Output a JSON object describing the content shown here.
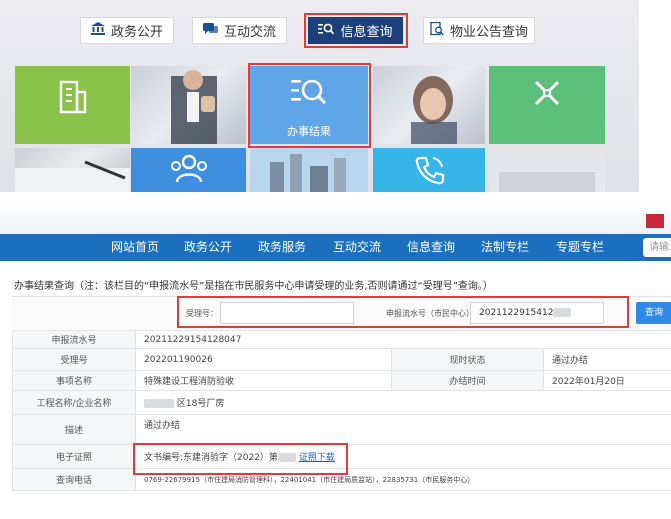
{
  "portal": {
    "tabs": [
      {
        "label": "政务公开",
        "icon": "bank-icon"
      },
      {
        "label": "互动交流",
        "icon": "chat-icon"
      },
      {
        "label": "信息查询",
        "icon": "search-list-icon",
        "active": true
      },
      {
        "label": "物业公告查询",
        "icon": "document-search-icon"
      }
    ],
    "highlight_tile_label": "办事结果"
  },
  "nav": {
    "items": [
      "网站首页",
      "政务公开",
      "政务服务",
      "互动交流",
      "信息查询",
      "法制专栏",
      "专题专栏"
    ],
    "search_placeholder": "请输入"
  },
  "notice": "办事结果查询（注：该栏目的“申报流水号”是指在市民服务中心申请受理的业务,否则请通过“受理号”查询。）",
  "search": {
    "accept_label": "受理号：",
    "accept_value": "",
    "serial_label": "申报流水号（市民中心）：",
    "serial_value": "2021122915412",
    "button": "查询"
  },
  "result": {
    "serial_key": "申报流水号",
    "serial_value": "20211229154128047",
    "accept_key": "受理号",
    "accept_value": "202201190026",
    "status_key": "现时状态",
    "status_value": "通过办结",
    "item_key": "事项名称",
    "item_value": "特殊建设工程消防验收",
    "time_key": "办结时间",
    "time_value": "2022年01月20日",
    "project_key": "工程名称/企业名称",
    "project_value": "区18号厂房",
    "desc_key": "描述",
    "desc_value": "通过办结",
    "cert_key": "电子证照",
    "cert_value": "文书编号:东建消验字（2022）第",
    "cert_link": "证照下载",
    "phone_key": "查询电话",
    "phone_value": "0769-22679915（市住建局消防管理科），22401041（市住建局质监站），22835731（市民服务中心）"
  },
  "colors": {
    "nav_blue": "#1c6fbf",
    "portal_active": "#1d3f7a",
    "highlight_red": "#e23b3b",
    "button_blue": "#2e8ae6"
  }
}
